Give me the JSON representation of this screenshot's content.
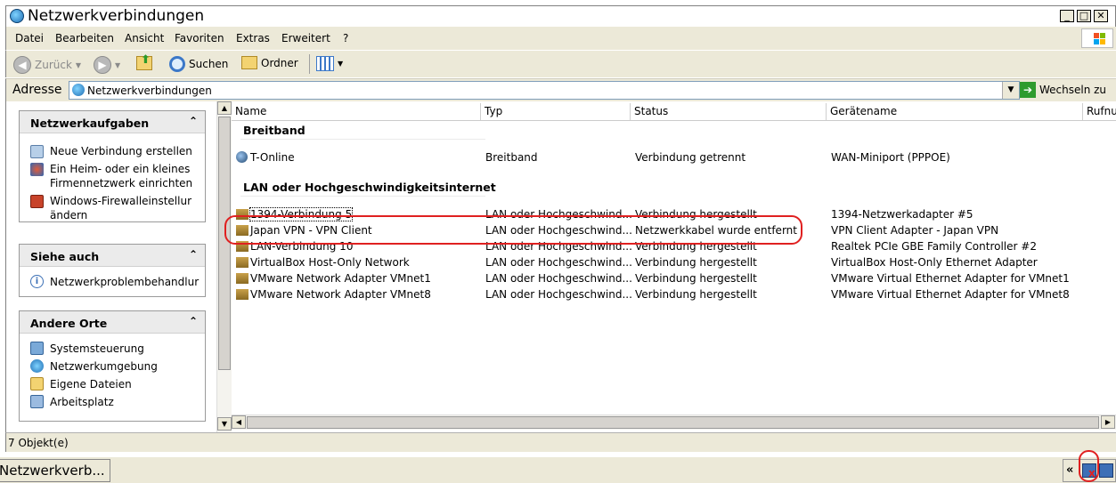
{
  "window": {
    "title": "Netzwerkverbindungen"
  },
  "menu": [
    "Datei",
    "Bearbeiten",
    "Ansicht",
    "Favoriten",
    "Extras",
    "Erweitert",
    "?"
  ],
  "toolbar": {
    "back": "Zurück",
    "search": "Suchen",
    "folders": "Ordner"
  },
  "address": {
    "label": "Adresse",
    "value": "Netzwerkverbindungen",
    "go": "Wechseln zu"
  },
  "tasks": {
    "network": {
      "title": "Netzwerkaufgaben",
      "items": [
        "Neue Verbindung erstellen",
        "Ein Heim- oder ein kleines Firmennetzwerk einrichten",
        "Windows-Firewalleinstellur ändern"
      ]
    },
    "see_also": {
      "title": "Siehe auch",
      "items": [
        "Netzwerkproblembehandlur"
      ]
    },
    "other": {
      "title": "Andere Orte",
      "items": [
        "Systemsteuerung",
        "Netzwerkumgebung",
        "Eigene Dateien",
        "Arbeitsplatz"
      ]
    }
  },
  "columns": [
    "Name",
    "Typ",
    "Status",
    "Gerätename",
    "Rufnu"
  ],
  "groups": [
    "Breitband",
    "LAN oder Hochgeschwindigkeitsinternet"
  ],
  "broadband": [
    {
      "name": "T-Online",
      "type": "Breitband",
      "status": "Verbindung getrennt",
      "device": "WAN-Miniport (PPPOE)"
    }
  ],
  "lan": [
    {
      "name": "1394-Verbindung 5",
      "type": "LAN oder Hochgeschwind...",
      "status": "Verbindung hergestellt",
      "device": "1394-Netzwerkadapter #5"
    },
    {
      "name": "Japan VPN - VPN Client",
      "type": "LAN oder Hochgeschwind...",
      "status": "Netzwerkkabel wurde entfernt",
      "device": "VPN Client Adapter - Japan VPN"
    },
    {
      "name": "LAN-Verbindung 10",
      "type": "LAN oder Hochgeschwind...",
      "status": "Verbindung hergestellt",
      "device": "Realtek PCIe GBE Family Controller #2"
    },
    {
      "name": "VirtualBox Host-Only Network",
      "type": "LAN oder Hochgeschwind...",
      "status": "Verbindung hergestellt",
      "device": "VirtualBox Host-Only Ethernet Adapter"
    },
    {
      "name": "VMware Network Adapter VMnet1",
      "type": "LAN oder Hochgeschwind...",
      "status": "Verbindung hergestellt",
      "device": "VMware Virtual Ethernet Adapter for VMnet1"
    },
    {
      "name": "VMware Network Adapter VMnet8",
      "type": "LAN oder Hochgeschwind...",
      "status": "Verbindung hergestellt",
      "device": "VMware Virtual Ethernet Adapter for VMnet8"
    }
  ],
  "status": {
    "text": "7 Objekt(e)"
  },
  "taskbar": {
    "button": "Netzwerkverb..."
  },
  "colors": {
    "highlight": "#e02020",
    "task_head": "#ebebeb",
    "chrome": "#ece9d8"
  },
  "icons": [
    "network-connections-icon",
    "back-arrow-icon",
    "forward-arrow-icon",
    "up-folder-icon",
    "search-icon",
    "folders-icon",
    "views-icon",
    "go-arrow-icon",
    "network-tray-icon",
    "disconnected-network-tray-icon"
  ]
}
